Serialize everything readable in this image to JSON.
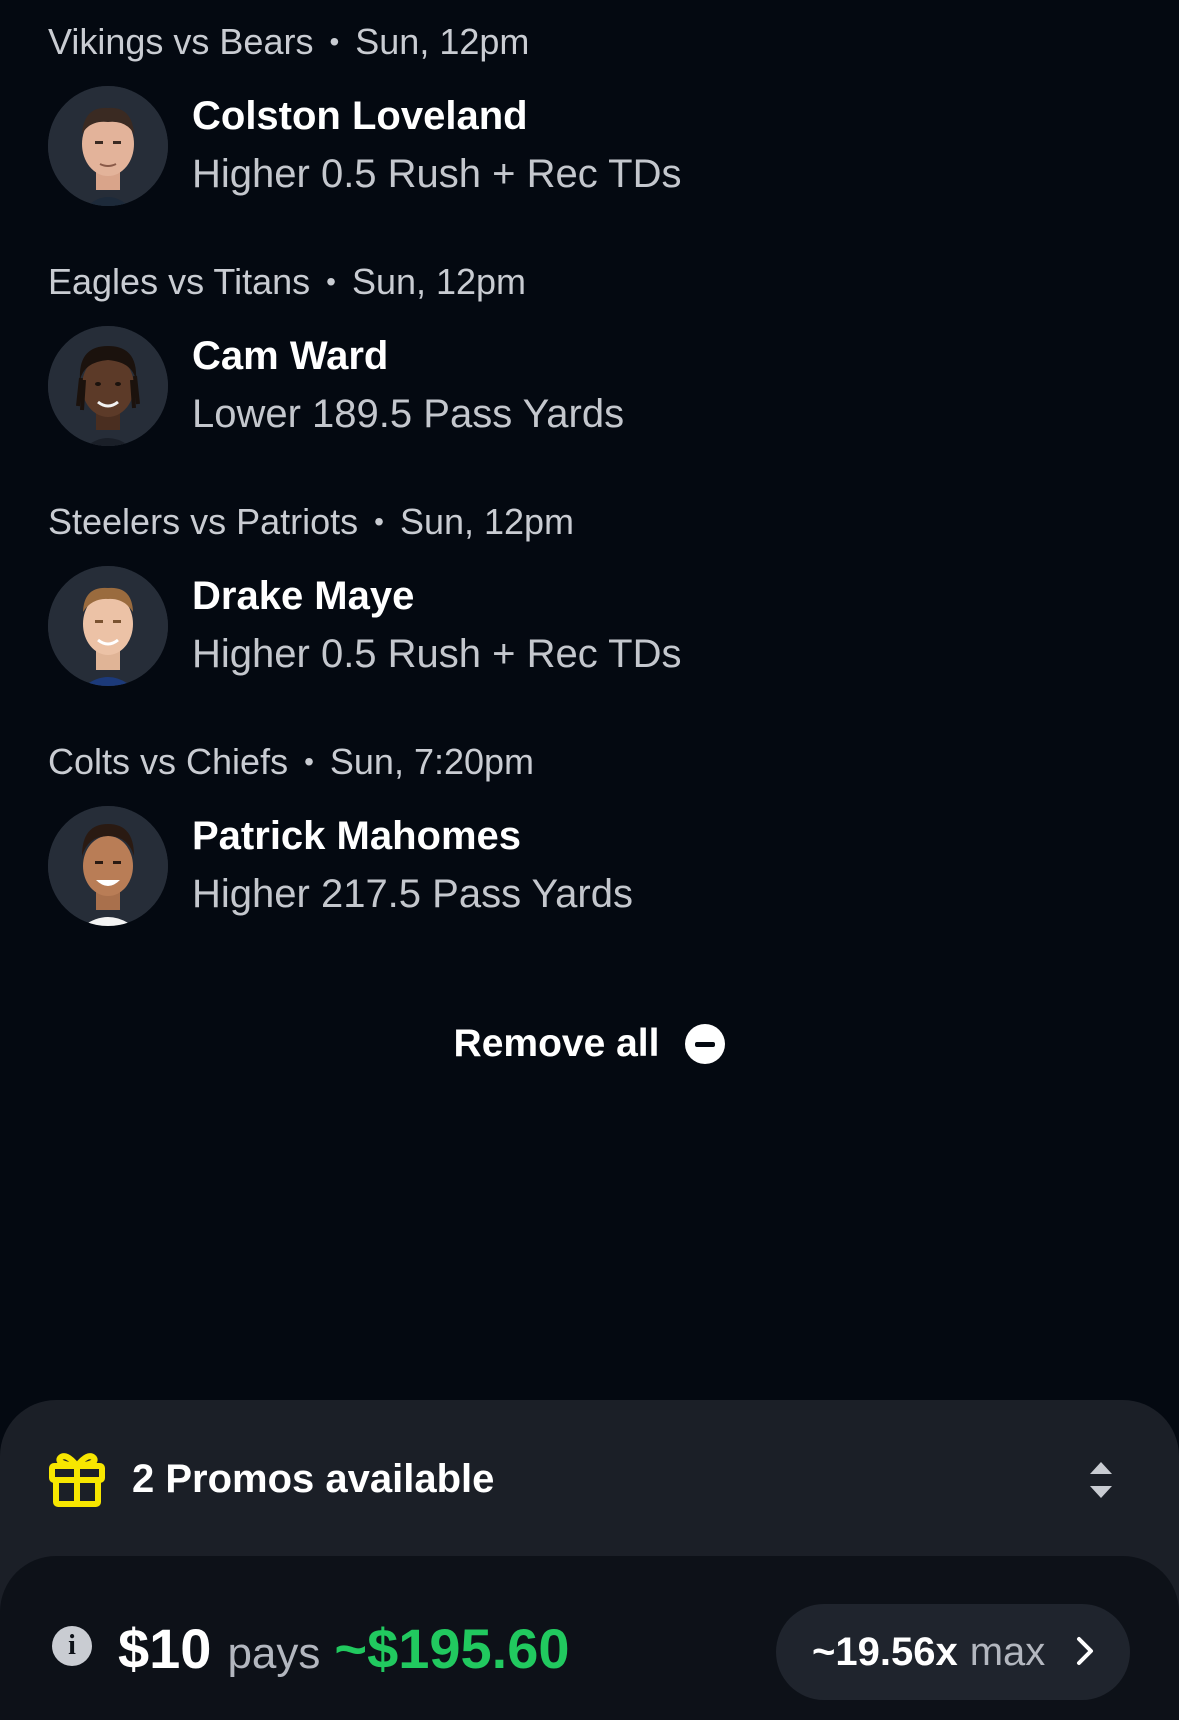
{
  "picks": [
    {
      "game": "Vikings vs Bears",
      "time": "Sun, 12pm",
      "player": "Colston Loveland",
      "line": "Higher 0.5 Rush + Rec TDs"
    },
    {
      "game": "Eagles vs Titans",
      "time": "Sun, 12pm",
      "player": "Cam Ward",
      "line": "Lower 189.5 Pass Yards"
    },
    {
      "game": "Steelers vs Patriots",
      "time": "Sun, 12pm",
      "player": "Drake Maye",
      "line": "Higher 0.5 Rush + Rec TDs"
    },
    {
      "game": "Colts vs Chiefs",
      "time": "Sun, 7:20pm",
      "player": "Patrick Mahomes",
      "line": "Higher 217.5 Pass Yards"
    }
  ],
  "separator": "•",
  "remove_all": {
    "label": "Remove all",
    "icon": "minus-circle-icon"
  },
  "promo": {
    "label": "2 Promos available",
    "icon": "gift-icon",
    "toggle_icon": "sort-arrows-icon"
  },
  "payout": {
    "info_icon": "i",
    "stake": "$10",
    "pays_word": "pays",
    "amount": "~$195.60",
    "multiplier": "~19.56x",
    "max_word": "max"
  },
  "colors": {
    "background": "#040911",
    "sheet": "#1b1f27",
    "accent_green": "#21c95f",
    "gift_yellow": "#f7e600"
  }
}
